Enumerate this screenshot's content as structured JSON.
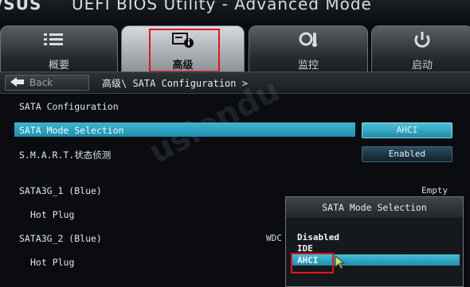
{
  "window": {
    "brand": "/SUS",
    "title": "UEFI BIOS Utility - Advanced Mode"
  },
  "tabs": [
    {
      "label": "概要",
      "icon": "list-icon",
      "active": false
    },
    {
      "label": "高级",
      "icon": "advanced-info-icon",
      "active": true
    },
    {
      "label": "监控",
      "icon": "monitor-gauge-icon",
      "active": false
    },
    {
      "label": "启动",
      "icon": "power-icon",
      "active": false
    }
  ],
  "breadcrumb": {
    "back_label": "Back",
    "path": "高级\\ SATA Configuration >"
  },
  "settings": {
    "section_title": "SATA Configuration",
    "rows": [
      {
        "label": "SATA Mode Selection",
        "value": "AHCI"
      },
      {
        "label": "S.M.A.R.T.状态侦测",
        "value": "Enabled"
      },
      {
        "label": "SATA3G_1 (Blue)",
        "value": "Empty"
      },
      {
        "label": "Hot Plug",
        "value": ""
      },
      {
        "label": "SATA3G_2 (Blue)",
        "value": "WDC"
      },
      {
        "label": "Hot Plug",
        "value": ""
      }
    ]
  },
  "popup": {
    "title": "SATA Mode Selection",
    "options": [
      "Disabled",
      "IDE",
      "AHCI"
    ],
    "selected": "AHCI"
  },
  "watermark": "uslendu",
  "colors": {
    "highlight_red": "#e0151b",
    "selection_cyan": "#2aa3c2"
  }
}
